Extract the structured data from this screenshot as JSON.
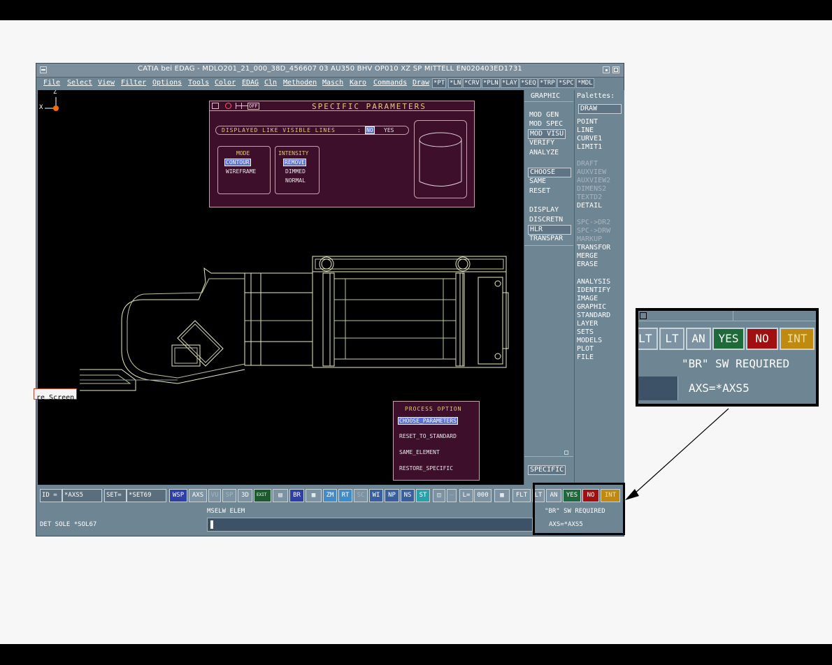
{
  "window": {
    "title": "CATIA bei EDAG - MDLO201_21_000_38D_456607    03 AU350 BHV  OP010 XZ SP MITTELL EN020403ED1731"
  },
  "menu": [
    "File",
    "Select",
    "View",
    "Filter",
    "Options",
    "Tools",
    "Color",
    "EDAG",
    "Cln",
    "Methoden",
    "Masch",
    "Karo",
    "Commands",
    "Draw"
  ],
  "asterisk_buttons": [
    "*PT",
    "*LN",
    "*CRV",
    "*PLN",
    "*LAY",
    "*SEQ",
    "*TRP",
    "*SPC",
    "*MDL"
  ],
  "graphic_panel": {
    "header": "GRAPHIC",
    "items": [
      "MOD GEN",
      "MOD SPEC",
      "MOD VISU",
      "VERIFY",
      "ANALYZE",
      "CHOOSE",
      "SAME",
      "RESET",
      "DISPLAY",
      "DISCRETN",
      "HLR",
      "TRANSPAR"
    ],
    "specific": "SPECIFIC"
  },
  "palettes": {
    "header": "Palettes:",
    "selected": "DRAW",
    "items": [
      "POINT",
      "LINE",
      "CURVE1",
      "LIMIT1",
      "DRAFT",
      "AUXVIEW",
      "AUXVIEW2",
      "DIMENS2",
      "TEXTD2",
      "DETAIL",
      "SPC->DR2",
      "SPC->DRW",
      "MARKUP",
      "TRANSFOR",
      "MERGE",
      "ERASE",
      "ANALYSIS",
      "IDENTIFY",
      "IMAGE",
      "GRAPHIC",
      "STANDARD",
      "LAYER",
      "SETS",
      "MODELS",
      "PLOT",
      "FILE"
    ]
  },
  "axis": {
    "z": "Z",
    "x": "X"
  },
  "specific_dialog": {
    "off": "OFF",
    "title": "SPECIFIC PARAMETERS",
    "displayed_label": "DISPLAYED LIKE VISIBLE LINES",
    "colon": ":",
    "no": "NO",
    "yes": "YES",
    "mode_header": "MODE",
    "mode_options": [
      "CONTOUR",
      "WIREFRAME"
    ],
    "intensity_header": "INTENSITY",
    "intensity_options": [
      "REMOVE",
      "DIMMED",
      "NORMAL"
    ]
  },
  "process_option": {
    "title": "PROCESS OPTION",
    "items": [
      "CHOOSE_PARAMETERS",
      "RESET_TO_STANDARD",
      "SAME_ELEMENT",
      "RESTORE_SPECIFIC"
    ]
  },
  "tooltip": "re Screen",
  "bottom": {
    "id_label": "ID =",
    "id_value": "*AXS5",
    "set_label": "SET=",
    "set_value": "*SET69",
    "buttons": [
      "WSP",
      "AXS",
      "VU",
      "SP",
      "3D",
      "EXIT",
      "BR",
      "ZM",
      "RT",
      "SC",
      "WI",
      "NP",
      "NS",
      "ST",
      "L=",
      "000",
      "FLT",
      "LT",
      "AN",
      "YES",
      "NO",
      "INT"
    ],
    "prompt": "MSELW ELEM",
    "status_left": "DET SOLE *SOL67",
    "status_right1": "\"BR\" SW REQUIRED",
    "status_right2": "AXS=*AXS5"
  },
  "zoom_inset": {
    "buttons": [
      "FLT",
      "LT",
      "AN",
      "YES",
      "NO",
      "INT"
    ],
    "line1": "\"BR\" SW REQUIRED",
    "line2": "AXS=*AXS5"
  }
}
